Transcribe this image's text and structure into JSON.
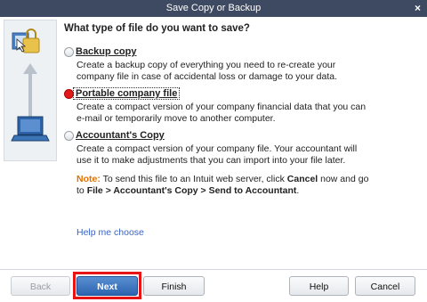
{
  "window": {
    "title": "Save Copy or Backup",
    "close_glyph": "×"
  },
  "heading": "What type of file do you want to save?",
  "options": [
    {
      "label": "Backup copy",
      "description": "Create a backup copy of everything you need to re-create your company file in case of accidental loss or damage to your data.",
      "selected": false
    },
    {
      "label": "Portable company file",
      "description": "Create a compact version of your company financial data that you can e-mail or temporarily move to another computer.",
      "selected": true
    },
    {
      "label": "Accountant's Copy",
      "description": "Create a compact version of your company file. Your accountant will use it to make adjustments that you can import into your file later.",
      "selected": false
    }
  ],
  "note": {
    "label": "Note:",
    "text_1": "To send this file to an Intuit web server, click",
    "cancel": "Cancel",
    "text_2": "now and go to",
    "path": "File > Accountant's Copy > Send to Accountant",
    "end": "."
  },
  "help_link": "Help me choose",
  "buttons": {
    "back": "Back",
    "next": "Next",
    "finish": "Finish",
    "help": "Help",
    "cancel": "Cancel"
  },
  "icons": [
    "window-close-icon",
    "backup-folder-icon",
    "lock-icon",
    "laptop-icon",
    "up-arrow-icon",
    "cursor-icon"
  ],
  "colors": {
    "titlebar": "#3e4a61",
    "selected_radio": "#e01919",
    "note_label": "#e07000",
    "link": "#3a63c4",
    "highlight": "#e81414",
    "primary_button": "#2c64b1"
  }
}
